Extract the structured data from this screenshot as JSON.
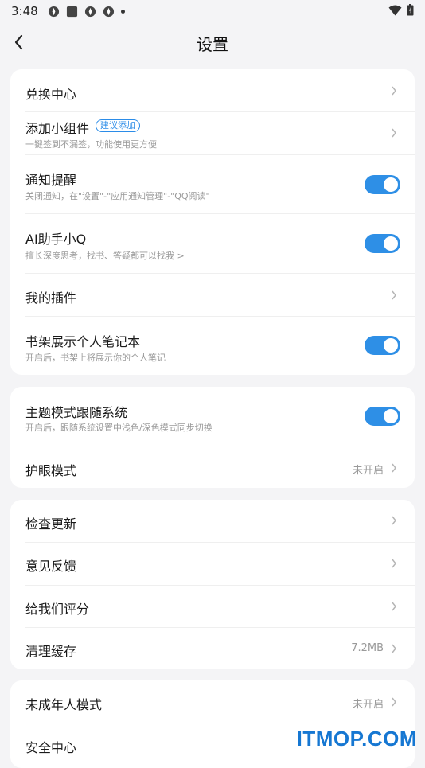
{
  "status_bar": {
    "time": "3:48"
  },
  "header": {
    "title": "设置"
  },
  "card1": {
    "redeem": {
      "label": "兑换中心"
    },
    "widget": {
      "label": "添加小组件",
      "badge": "建议添加",
      "sub": "一键签到不漏签，功能使用更方便"
    },
    "notify": {
      "label": "通知提醒",
      "sub": "关闭通知，在\"设置\"-\"应用通知管理\"-\"QQ阅读\"",
      "enabled": true
    },
    "ai": {
      "label": "AI助手小Q",
      "sub": "擅长深度思考，找书、答疑都可以找我 >",
      "enabled": true
    },
    "plugins": {
      "label": "我的插件"
    },
    "notebook": {
      "label": "书架展示个人笔记本",
      "sub": "开启后，书架上将展示你的个人笔记",
      "enabled": true
    }
  },
  "card2": {
    "theme": {
      "label": "主题模式跟随系统",
      "sub": "开启后，跟随系统设置中浅色/深色模式同步切换",
      "enabled": true
    },
    "eye": {
      "label": "护眼模式",
      "value": "未开启"
    }
  },
  "card3": {
    "update": {
      "label": "检查更新"
    },
    "feedback": {
      "label": "意见反馈"
    },
    "rate": {
      "label": "给我们评分"
    },
    "cache": {
      "label": "清理缓存",
      "value": "7.2MB"
    }
  },
  "card4": {
    "minor": {
      "label": "未成年人模式",
      "value": "未开启"
    },
    "security": {
      "label": "安全中心"
    }
  },
  "watermark": "ITMOP.COM",
  "colors": {
    "accent": "#2e8fe6",
    "background": "#f4f4f6",
    "card": "#ffffff"
  },
  "icons": [
    "back-icon",
    "chevron-right-icon",
    "wifi-icon",
    "battery-icon"
  ]
}
